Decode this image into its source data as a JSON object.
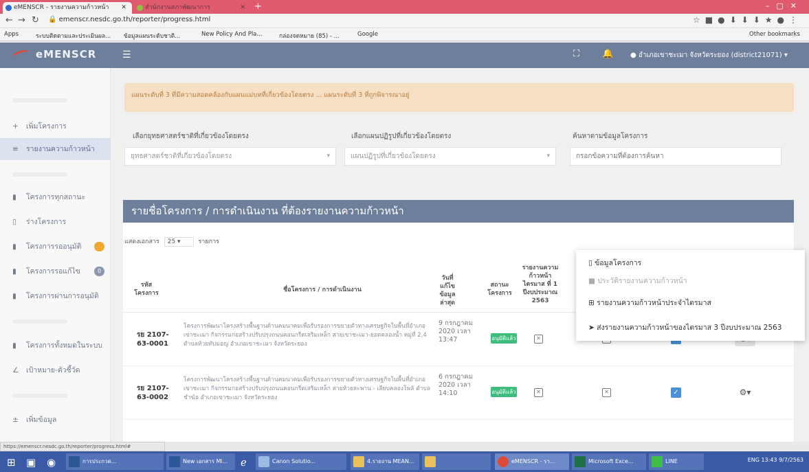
{
  "browser": {
    "tab_active": "eMENSCR - รายงานความก้าวหน้า",
    "tab_other": "สำนักงานสภาพัฒนาการ",
    "url": "emenscr.nesdc.go.th/reporter/progress.html",
    "status_url": "https://emenscr.nesdc.go.th/reporter/progress.html#",
    "bookmarks": [
      "Apps",
      "ระบบติดตามและประเมินผล...",
      "ข้อมูลแผนระดับชาติ...",
      "New Policy And Pla...",
      "กล่องจดหมาย (85) - ...",
      "Google"
    ],
    "other_bookmarks": "Other bookmarks"
  },
  "header": {
    "logo": "eMENSCR",
    "user": "อำเภอเขาชะเมา จังหวัดระยอง (district21071)"
  },
  "sidebar": {
    "items": [
      {
        "icon": "+",
        "label": "เพิ่มโครงการ"
      },
      {
        "icon": "≡",
        "label": "รายงานความก้าวหน้า"
      },
      {
        "icon": "■",
        "label": "โครงการทุกสถานะ"
      },
      {
        "icon": "□",
        "label": "ร่างโครงการ"
      },
      {
        "icon": "■",
        "label": "โครงการรออนุมัติ"
      },
      {
        "icon": "■",
        "label": "โครงการรอแก้ไข"
      },
      {
        "icon": "■",
        "label": "โครงการผ่านการอนุมัติ"
      },
      {
        "icon": "■",
        "label": "โครงการทั้งหมดในระบบ"
      },
      {
        "icon": "∠",
        "label": "เป้าหมาย-ตัวชี้วัด"
      },
      {
        "icon": "±",
        "label": "เพิ่มข้อมูล"
      }
    ],
    "badge_pending": "",
    "badge_edit": "0"
  },
  "alert": {
    "text": "แผนระดับที่ 3 ที่มีความสอดคล้องกับแผนแม่บทที่เกี่ยวข้องโดยตรง ... แผนระดับที่ 3 ที่ถูกพิจารณาอยู่"
  },
  "filters": [
    {
      "label": "เลือกยุทธศาสตร์ชาติที่เกี่ยวข้องโดยตรง",
      "placeholder": "ยุทธศาสตร์ชาติที่เกี่ยวข้องโดยตรง"
    },
    {
      "label": "เลือกแผนปฏิรูปที่เกี่ยวข้องโดยตรง",
      "placeholder": "แผนปฏิรูปที่เกี่ยวข้องโดยตรง"
    },
    {
      "label": "ค้นหาตามข้อมูลโครงการ",
      "placeholder": "กรอกข้อความที่ต้องการค้นหา"
    }
  ],
  "table": {
    "title": "รายชื่อโครงการ / การดำเนินงาน ที่ต้องรายงานความก้าวหน้า",
    "length_prefix": "แสดงเอกสาร",
    "length_value": "25",
    "length_suffix": "รายการ",
    "headers": {
      "code": "รหัส โครงการ",
      "name": "ชื่อโครงการ / การดำเนินงาน",
      "date": "วันที่ แก้ไข ข้อมูล ล่าสุด",
      "status": "สถานะ โครงการ",
      "report": "รายงานความ ก้าวหน้าไตรมาส ที่ 1 ปีงบประมาณ 2563"
    },
    "rows": [
      {
        "code": "รย 2107-63-0001",
        "name": "โครงการพัฒนาโครงสร้างพื้นฐานด้านคมนาคมเพื่อรับรองการขยายตัวทางเศรษฐกิจในพื้นที่อำเภอเขาชะเมา กิจกรรมก่อสร้างปรับปรุงถนนคอนกรีตเสริมเหล็ก สายเขาชะเมา-ยอดคลองน้ำ หมู่ที่ 2,4 ตำบลห้วยทับมอญ อำเภอเขาชะเมา จังหวัดระยอง",
        "date": "9 กรกฎาคม 2020 เวลา 13:47",
        "status": "อนุมัติแล้ว"
      },
      {
        "code": "รย 2107-63-0002",
        "name": "โครงการพัฒนาโครงสร้างพื้นฐานด้านคมนาคมเพื่อรับรองการขยายตัวทางเศรษฐกิจในพื้นที่อำเภอเขาชะเมา กิจกรรมก่อสร้างปรับปรุงถนนคอนกรีตเสริมเหล็ก สายห้วยสะพาน - เลียบคลองโพล้ ตำบลชำฆ้อ อำเภอเขาชะเมา จังหวัดระยอง",
        "date": "6 กรกฎาคม 2020 เวลา 14:10",
        "status": "อนุมัติแล้ว"
      }
    ]
  },
  "dropdown": {
    "items": [
      "ข้อมูลโครงการ",
      "ประวัติรายงานความก้าวหน้า",
      "รายงานความก้าวหน้าประจำไตรมาส",
      "ส่งรายงานความก้าวหน้าของไตรมาส 3 ปีงบประมาณ 2563"
    ]
  },
  "taskbar": {
    "apps": [
      "การประกวด...",
      "New เอกสาร Mi...",
      "Canon Solutio...",
      "4.รายงาน MEAN...",
      "",
      "eMENSCR - รา...",
      "Microsoft Exce...",
      "LINE"
    ],
    "sys": "ENG 13:43 9/7/2563"
  },
  "colors": {
    "tab_bar": "#e05a6e",
    "header": "#6e7f9c",
    "status_green": "#3dbc7d",
    "checkbox_blue": "#4a8fd8",
    "alert_bg": "#f7dfc3"
  }
}
